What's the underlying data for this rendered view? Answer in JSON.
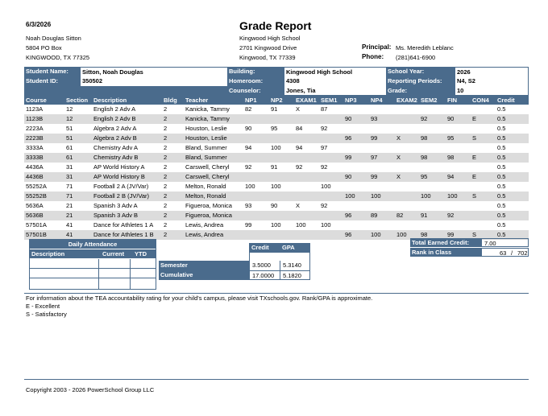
{
  "header": {
    "date": "6/3/2026",
    "title": "Grade Report",
    "student_addr": [
      "Noah Douglas Sitton",
      "5804  PO Box",
      "KINGWOOD, TX 77325"
    ],
    "school_addr": [
      "Kingwood High School",
      "2701 Kingwood Drive",
      "Kingwood, TX 77339"
    ],
    "principal_label": "Principal:",
    "principal": "Ms. Meredith Leblanc",
    "phone_label": "Phone:",
    "phone": "(281)641-6900"
  },
  "info": {
    "student_name_label": "Student Name:",
    "student_name": "Sitton, Noah Douglas",
    "student_id_label": "Student ID:",
    "student_id": "350502",
    "building_label": "Building:",
    "building": "Kingwood High School",
    "homeroom_label": "Homeroom:",
    "homeroom": "4308",
    "counselor_label": "Counselor:",
    "counselor": "Jones, Tia",
    "school_year_label": "School Year:",
    "school_year": "2026",
    "reporting_label": "Reporting Periods:",
    "reporting": "N4, S2",
    "grade_label": "Grade:",
    "grade": "10"
  },
  "columns": [
    "Course",
    "Section",
    "Description",
    "Bldg",
    "Teacher",
    "NP1",
    "NP2",
    "EXAM1",
    "SEM1",
    "NP3",
    "NP4",
    "EXAM2",
    "SEM2",
    "FIN",
    "CON4",
    "Credit"
  ],
  "rows": [
    [
      "1123A",
      "12",
      "English 2 Adv A",
      "2",
      "Kanicka, Tammy",
      "82",
      "91",
      "X",
      "87",
      "",
      "",
      "",
      "",
      "",
      "",
      "0.5"
    ],
    [
      "1123B",
      "12",
      "English 2 Adv B",
      "2",
      "Kanicka, Tammy",
      "",
      "",
      "",
      "",
      "90",
      "93",
      "",
      "92",
      "90",
      "E",
      "0.5"
    ],
    [
      "2223A",
      "51",
      "Algebra 2 Adv A",
      "2",
      "Houston, Leslie",
      "90",
      "95",
      "84",
      "92",
      "",
      "",
      "",
      "",
      "",
      "",
      "0.5"
    ],
    [
      "2223B",
      "51",
      "Algebra 2 Adv B",
      "2",
      "Houston, Leslie",
      "",
      "",
      "",
      "",
      "96",
      "99",
      "X",
      "98",
      "95",
      "S",
      "0.5"
    ],
    [
      "3333A",
      "61",
      "Chemistry Adv A",
      "2",
      "Bland, Summer",
      "94",
      "100",
      "94",
      "97",
      "",
      "",
      "",
      "",
      "",
      "",
      "0.5"
    ],
    [
      "3333B",
      "61",
      "Chemistry Adv B",
      "2",
      "Bland, Summer",
      "",
      "",
      "",
      "",
      "99",
      "97",
      "X",
      "98",
      "98",
      "E",
      "0.5"
    ],
    [
      "4436A",
      "31",
      "AP World History A",
      "2",
      "Carswell, Cheryl",
      "92",
      "91",
      "92",
      "92",
      "",
      "",
      "",
      "",
      "",
      "",
      "0.5"
    ],
    [
      "4436B",
      "31",
      "AP World History B",
      "2",
      "Carswell, Cheryl",
      "",
      "",
      "",
      "",
      "90",
      "99",
      "X",
      "95",
      "94",
      "E",
      "0.5"
    ],
    [
      "55252A",
      "71",
      "Football 2 A (JV/Var)",
      "2",
      "Melton, Ronald",
      "100",
      "100",
      "",
      "100",
      "",
      "",
      "",
      "",
      "",
      "",
      "0.5"
    ],
    [
      "55252B",
      "71",
      "Football 2 B (JV/Var)",
      "2",
      "Melton, Ronald",
      "",
      "",
      "",
      "",
      "100",
      "100",
      "",
      "100",
      "100",
      "S",
      "0.5"
    ],
    [
      "5636A",
      "21",
      "Spanish 3 Adv A",
      "2",
      "Figueroa, Monica",
      "93",
      "90",
      "X",
      "92",
      "",
      "",
      "",
      "",
      "",
      "",
      "0.5"
    ],
    [
      "5636B",
      "21",
      "Spanish 3 Adv B",
      "2",
      "Figueroa, Monica",
      "",
      "",
      "",
      "",
      "96",
      "89",
      "82",
      "91",
      "92",
      "",
      "0.5"
    ],
    [
      "57501A",
      "41",
      "Dance for Athletes 1 A",
      "2",
      "Lewis, Andrea",
      "99",
      "100",
      "100",
      "100",
      "",
      "",
      "",
      "",
      "",
      "",
      "0.5"
    ],
    [
      "57501B",
      "41",
      "Dance for Athletes 1 B",
      "2",
      "Lewis, Andrea",
      "",
      "",
      "",
      "",
      "96",
      "100",
      "100",
      "98",
      "99",
      "S",
      "0.5"
    ]
  ],
  "attendance": {
    "title": "Daily Attendance",
    "cols": [
      "Description",
      "Current",
      "YTD"
    ]
  },
  "gpa": {
    "credit_label": "Credit",
    "gpa_label": "GPA",
    "semester_label": "Semester",
    "semester_credit": "3.5000",
    "semester_gpa": "5.3140",
    "cumulative_label": "Cumulative",
    "cumulative_credit": "17.0000",
    "cumulative_gpa": "5.1820"
  },
  "totals": {
    "earned_label": "Total Earned Credit:",
    "earned": "7.00",
    "rank_label": "Rank in Class",
    "rank": "63",
    "rank_sep": "/",
    "rank_of": "702"
  },
  "footer": {
    "note": "For information about the TEA accountability rating for your child's campus, please visit TXschools.gov. Rank/GPA is approximate.",
    "legend1": "E - Excellent",
    "legend2": "S - Satisfactory",
    "copyright": "Copyright 2003 - 2026  PowerSchool Group LLC"
  }
}
